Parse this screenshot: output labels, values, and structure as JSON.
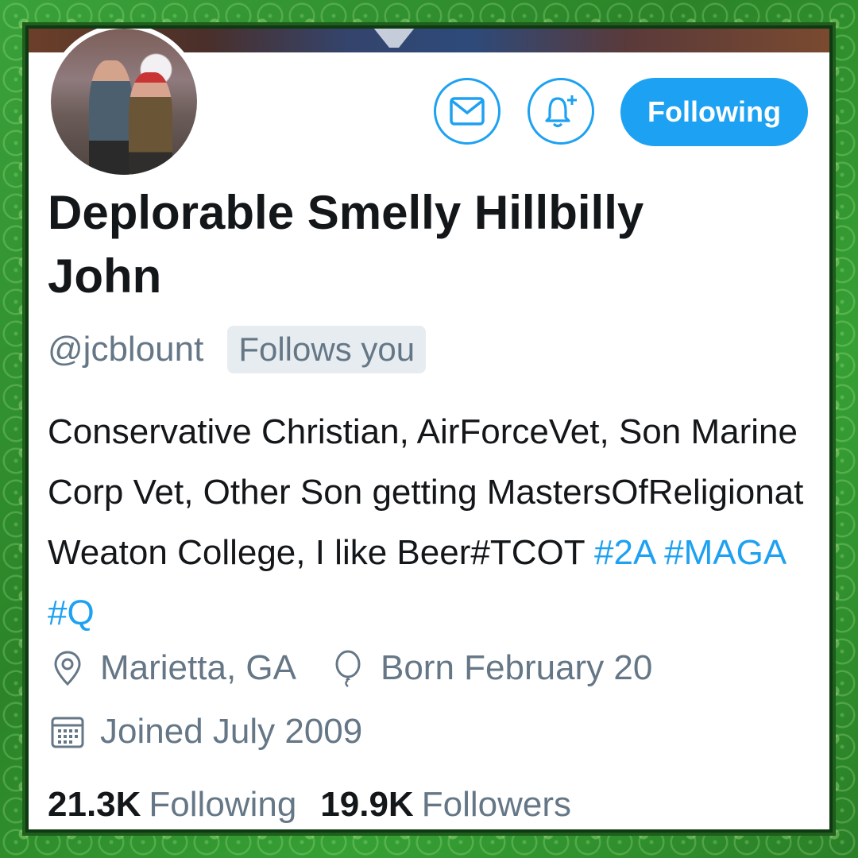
{
  "profile": {
    "display_name": "Deplorable Smelly Hillbilly John",
    "handle": "@jcblount",
    "follows_you_badge": "Follows you",
    "bio_text": "Conservative Christian, AirForceVet, Son Marine Corp Vet, Other Son getting MastersOfReligionat Weaton College, I like Beer#TCOT",
    "bio_hashtags": [
      "#2A",
      "#MAGA",
      "#Q"
    ],
    "location": "Marietta, GA",
    "birthday": "Born February 20",
    "joined": "Joined July 2009"
  },
  "actions": {
    "message_icon": "envelope-icon",
    "notify_icon": "bell-plus-icon",
    "follow_button_label": "Following"
  },
  "stats": {
    "following_count": "21.3K",
    "following_label": "Following",
    "followers_count": "19.9K",
    "followers_label": "Followers"
  },
  "icons": {
    "location": "map-pin-icon",
    "birthday": "balloon-icon",
    "joined": "calendar-icon"
  },
  "colors": {
    "accent": "#1da1f2",
    "text_primary": "#14171a",
    "text_secondary": "#657786",
    "frame_green": "#2f8a2a"
  }
}
